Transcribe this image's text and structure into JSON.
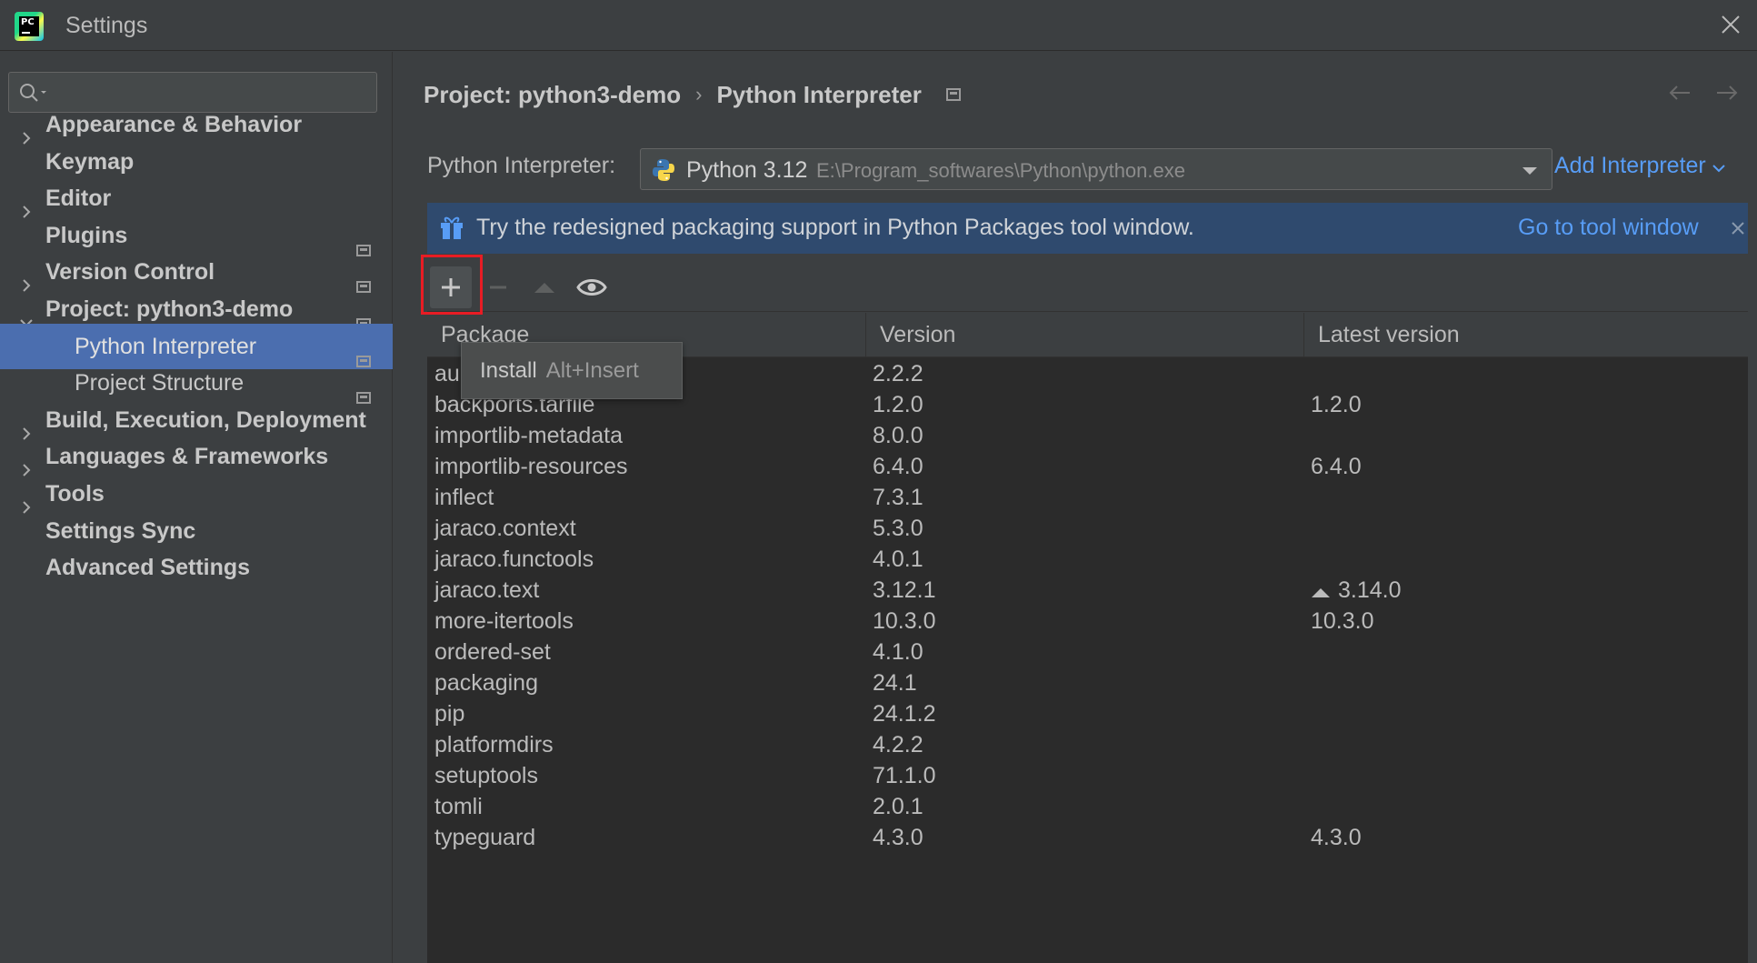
{
  "window": {
    "title": "Settings",
    "logo_text": "PC"
  },
  "sidebar": {
    "search_placeholder": "",
    "items": [
      {
        "label": "Appearance & Behavior",
        "chevron": "right"
      },
      {
        "label": "Keymap"
      },
      {
        "label": "Editor",
        "chevron": "right"
      },
      {
        "label": "Plugins",
        "badge": true
      },
      {
        "label": "Version Control",
        "chevron": "right",
        "badge": true
      },
      {
        "label": "Project: python3-demo",
        "chevron": "down",
        "badge": true
      },
      {
        "label": "Python Interpreter",
        "sub": true,
        "selected": true,
        "badge": true
      },
      {
        "label": "Project Structure",
        "sub": true,
        "badge": true
      },
      {
        "label": "Build, Execution, Deployment",
        "chevron": "right"
      },
      {
        "label": "Languages & Frameworks",
        "chevron": "right"
      },
      {
        "label": "Tools",
        "chevron": "right"
      },
      {
        "label": "Settings Sync"
      },
      {
        "label": "Advanced Settings"
      }
    ]
  },
  "breadcrumb": {
    "project": "Project: python3-demo",
    "separator": "›",
    "page": "Python Interpreter"
  },
  "interpreter": {
    "label": "Python Interpreter:",
    "name": "Python 3.12",
    "path": "E:\\Program_softwares\\Python\\python.exe",
    "add_label": "Add Interpreter"
  },
  "banner": {
    "text": "Try the redesigned packaging support in Python Packages tool window.",
    "link": "Go to tool window"
  },
  "tooltip": {
    "label": "Install",
    "shortcut": "Alt+Insert"
  },
  "table": {
    "headers": [
      "Package",
      "Version",
      "Latest version"
    ],
    "rows": [
      {
        "package": "au",
        "version": "2.2.2",
        "latest": ""
      },
      {
        "package": "backports.tarfile",
        "version": "1.2.0",
        "latest": "1.2.0"
      },
      {
        "package": "importlib-metadata",
        "version": "8.0.0",
        "latest": ""
      },
      {
        "package": "importlib-resources",
        "version": "6.4.0",
        "latest": "6.4.0"
      },
      {
        "package": "inflect",
        "version": "7.3.1",
        "latest": ""
      },
      {
        "package": "jaraco.context",
        "version": "5.3.0",
        "latest": ""
      },
      {
        "package": "jaraco.functools",
        "version": "4.0.1",
        "latest": ""
      },
      {
        "package": "jaraco.text",
        "version": "3.12.1",
        "latest": "3.14.0",
        "upgrade": true
      },
      {
        "package": "more-itertools",
        "version": "10.3.0",
        "latest": "10.3.0"
      },
      {
        "package": "ordered-set",
        "version": "4.1.0",
        "latest": ""
      },
      {
        "package": "packaging",
        "version": "24.1",
        "latest": ""
      },
      {
        "package": "pip",
        "version": "24.1.2",
        "latest": ""
      },
      {
        "package": "platformdirs",
        "version": "4.2.2",
        "latest": ""
      },
      {
        "package": "setuptools",
        "version": "71.1.0",
        "latest": ""
      },
      {
        "package": "tomli",
        "version": "2.0.1",
        "latest": ""
      },
      {
        "package": "typeguard",
        "version": "4.3.0",
        "latest": "4.3.0"
      }
    ]
  },
  "colors": {
    "accent": "#589df6",
    "selection": "#4b6eaf",
    "banner_bg": "#2f4a6e",
    "highlight_box": "#e81c24"
  }
}
